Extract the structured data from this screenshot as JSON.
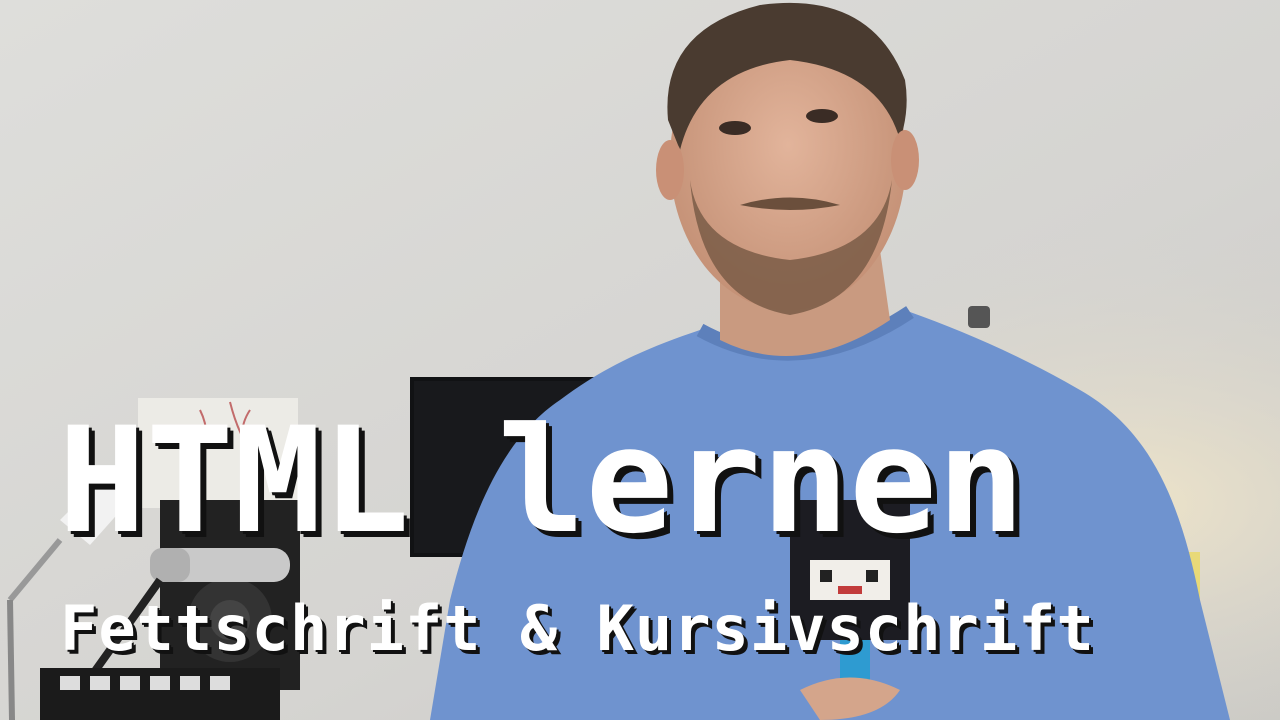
{
  "overlay": {
    "title": "HTML lernen",
    "subtitle": "Fettschrift & Kursivschrift"
  },
  "colors": {
    "text": "#ffffff",
    "text_shadow": "#111111",
    "wall": "#d9d8d4",
    "shirt": "#6f93cf",
    "skin": "#d9a98d",
    "hair": "#4a3b30"
  },
  "scene": {
    "subject": "presenter-in-blue-tshirt",
    "background_items": [
      "desk-lamp",
      "microphone",
      "monitor",
      "studio-speaker",
      "wall-sketch",
      "drum-pad-controller"
    ]
  }
}
